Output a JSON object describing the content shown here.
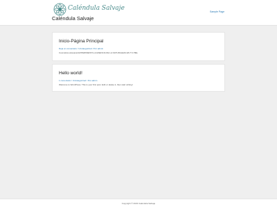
{
  "header": {
    "logo_text": "Caléndula Salvaje",
    "site_title": "Caléndula Salvaje",
    "nav": {
      "sample_page": "Sample Page"
    }
  },
  "posts": [
    {
      "title": "Inicio-Página Principal",
      "meta": "Deja un comentario / Uncategorized / Por admin",
      "excerpt": "Cosmética artesanal EXPERIMENTA LA ESENCIA DE LA NATURALEZA EN TU PIEL"
    },
    {
      "title": "Hello world!",
      "meta": "1 comentario / Uncategorized / Por admin",
      "excerpt": "Welcome to WordPress. This is your first post. Edit or delete it, then start writing!"
    }
  ],
  "footer": {
    "text": "Copyright © 2023 Caléndula Salvaje"
  },
  "colors": {
    "accent": "#2a7ab5",
    "logo": "#4a8c8c",
    "background": "#efefef"
  }
}
